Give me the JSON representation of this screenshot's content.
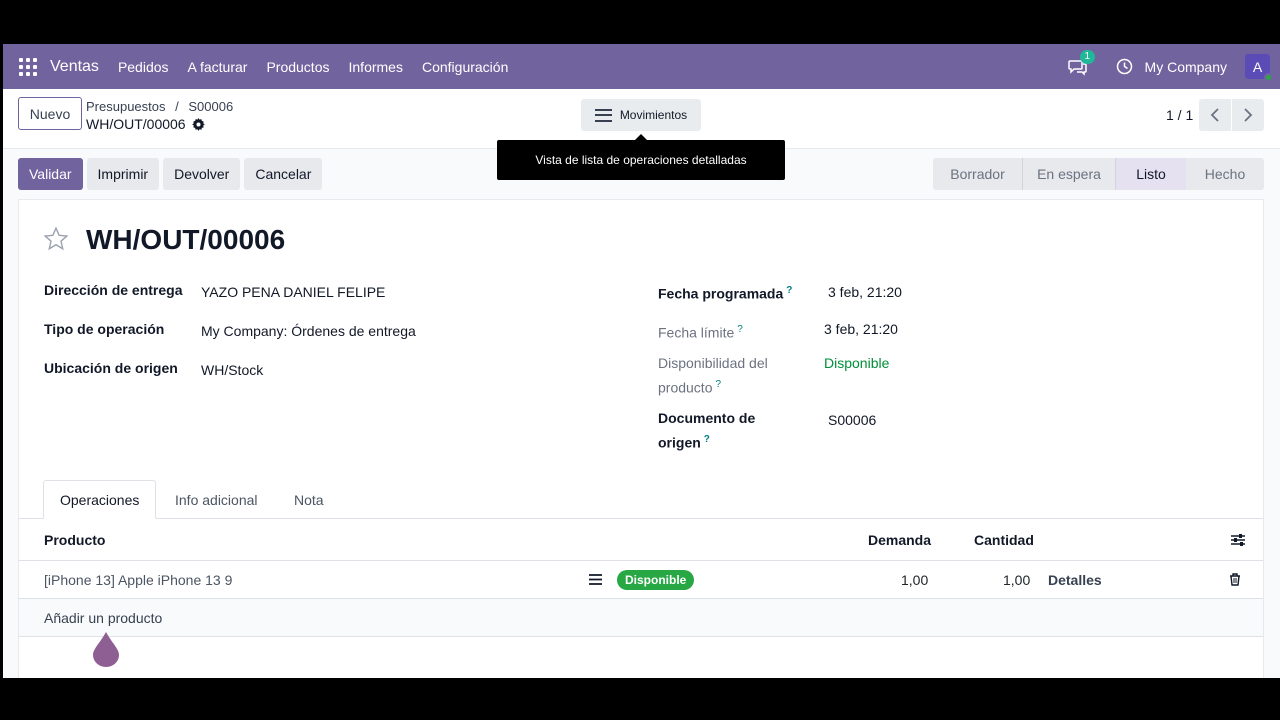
{
  "navbar": {
    "app_name": "Ventas",
    "menu": [
      "Pedidos",
      "A facturar",
      "Productos",
      "Informes",
      "Configuración"
    ],
    "message_count": "1",
    "company": "My Company",
    "avatar_letter": "A"
  },
  "control": {
    "new_label": "Nuevo",
    "breadcrumb": [
      "Presupuestos",
      "S00006"
    ],
    "record_name": "WH/OUT/00006",
    "movements_label": "Movimientos",
    "tooltip": "Vista de lista de operaciones detalladas",
    "pager": "1 / 1"
  },
  "actions": [
    "Validar",
    "Imprimir",
    "Devolver",
    "Cancelar"
  ],
  "status_stages": [
    "Borrador",
    "En espera",
    "Listo",
    "Hecho"
  ],
  "active_stage": "Listo",
  "form": {
    "title": "WH/OUT/00006",
    "left_fields": [
      {
        "label": "Dirección de entrega",
        "value": "YAZO PENA DANIEL FELIPE"
      },
      {
        "label": "Tipo de operación",
        "value": "My Company: Órdenes de entrega"
      },
      {
        "label": "Ubicación de origen",
        "value": "WH/Stock"
      }
    ],
    "right_fields": {
      "scheduled": {
        "label": "Fecha programada",
        "value": "3 feb, 21:20"
      },
      "deadline": {
        "label": "Fecha límite",
        "value": "3 feb, 21:20"
      },
      "availability": {
        "label_1": "Disponibilidad del",
        "label_2": "producto",
        "value": "Disponible"
      },
      "origin": {
        "label_1": "Documento de",
        "label_2": "origen",
        "value": "S00006"
      }
    },
    "help_mark": "?"
  },
  "tabs": [
    "Operaciones",
    "Info adicional",
    "Nota"
  ],
  "table": {
    "headers": {
      "product": "Producto",
      "demand": "Demanda",
      "quantity": "Cantidad"
    },
    "rows": [
      {
        "product": "[iPhone 13] Apple iPhone 13 9",
        "status": "Disponible",
        "demand": "1,00",
        "quantity": "1,00",
        "details": "Detalles"
      }
    ],
    "add_label": "Añadir un producto"
  },
  "colors": {
    "brand": "#71639e",
    "success": "#28a745",
    "teal": "#21b799"
  }
}
